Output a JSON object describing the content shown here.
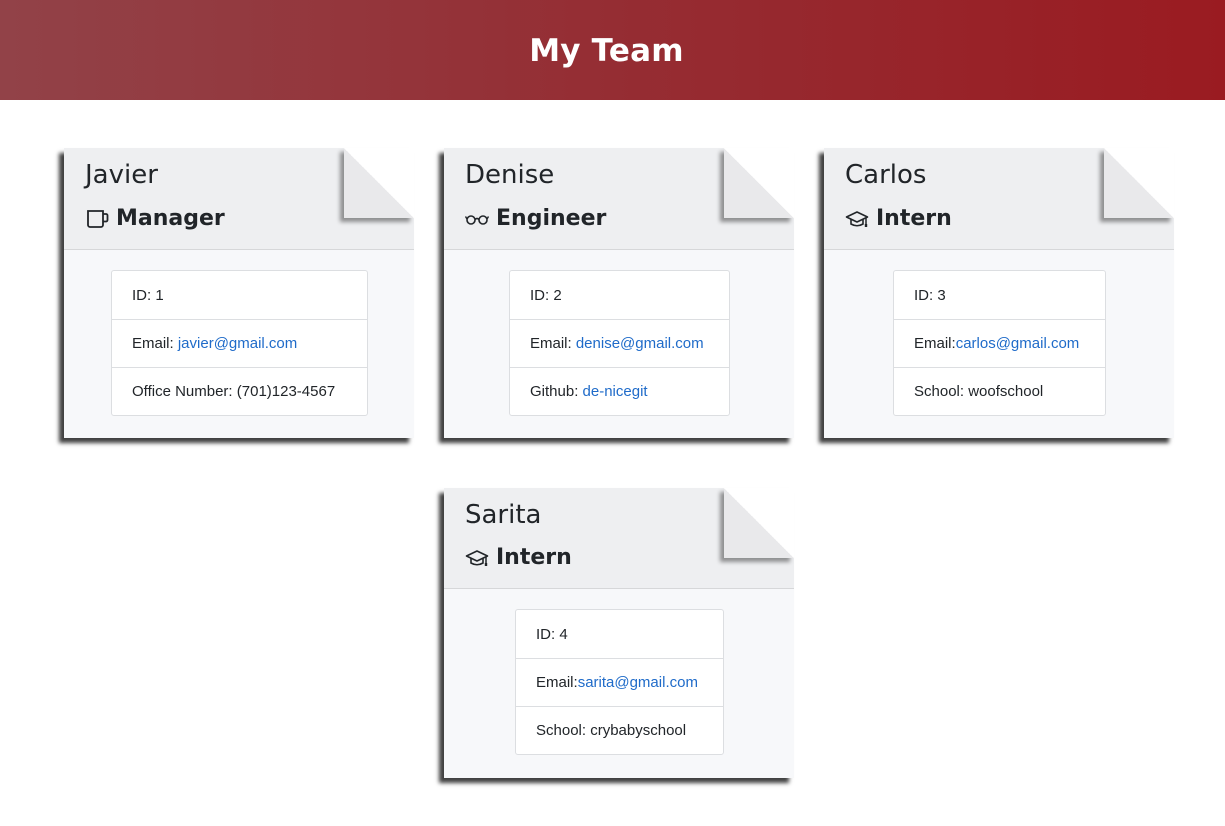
{
  "header": {
    "title": "My Team"
  },
  "colors": {
    "header_start": "#924248",
    "header_end": "#9a1b21",
    "link": "#1f6bc9"
  },
  "employees": [
    {
      "name": "Javier",
      "role": "Manager",
      "role_icon": "mug-icon",
      "id_label": "ID: 1",
      "email_label": "Email: ",
      "email": "javier@gmail.com",
      "extra_label": "Office Number: (701)123-4567",
      "extra_link": ""
    },
    {
      "name": "Denise",
      "role": "Engineer",
      "role_icon": "glasses-icon",
      "id_label": "ID: 2",
      "email_label": "Email: ",
      "email": "denise@gmail.com",
      "extra_label": "Github: ",
      "extra_link": "de-nicegit"
    },
    {
      "name": "Carlos",
      "role": "Intern",
      "role_icon": "graduation-cap-icon",
      "id_label": "ID: 3",
      "email_label": "Email:",
      "email": "carlos@gmail.com",
      "extra_label": "School: woofschool",
      "extra_link": ""
    },
    {
      "name": "Sarita",
      "role": "Intern",
      "role_icon": "graduation-cap-icon",
      "id_label": "ID: 4",
      "email_label": "Email:",
      "email": "sarita@gmail.com",
      "extra_label": "School: crybabyschool",
      "extra_link": ""
    }
  ]
}
